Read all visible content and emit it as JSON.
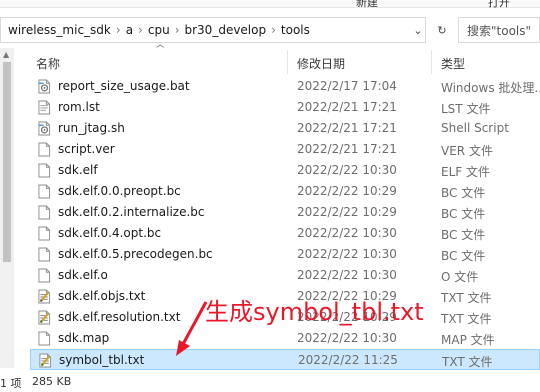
{
  "ribbon": {
    "left_label": "",
    "mid_label": "新建",
    "right_label": "打开"
  },
  "address": {
    "crumbs": [
      "wireless_mic_sdk",
      "a",
      "cpu",
      "br30_develop",
      "tools"
    ],
    "dropdown_glyph": "⌄",
    "refresh_glyph": "↻",
    "search_placeholder": "搜索\"tools\""
  },
  "columns": {
    "name": "名称",
    "date": "修改日期",
    "type": "类型"
  },
  "files": [
    {
      "name": "report_size_usage.bat",
      "date": "2022/2/17 17:04",
      "type": "Windows 批处理...",
      "icon": "batch-file-icon"
    },
    {
      "name": "rom.lst",
      "date": "2022/2/21 17:21",
      "type": "LST 文件",
      "icon": "text-file-icon"
    },
    {
      "name": "run_jtag.sh",
      "date": "2022/2/21 17:21",
      "type": "Shell Script",
      "icon": "script-file-icon"
    },
    {
      "name": "script.ver",
      "date": "2022/2/21 17:21",
      "type": "VER 文件",
      "icon": "blank-file-icon"
    },
    {
      "name": "sdk.elf",
      "date": "2022/2/22 10:30",
      "type": "ELF 文件",
      "icon": "blank-file-icon"
    },
    {
      "name": "sdk.elf.0.0.preopt.bc",
      "date": "2022/2/22 10:29",
      "type": "BC 文件",
      "icon": "blank-file-icon"
    },
    {
      "name": "sdk.elf.0.2.internalize.bc",
      "date": "2022/2/22 10:29",
      "type": "BC 文件",
      "icon": "blank-file-icon"
    },
    {
      "name": "sdk.elf.0.4.opt.bc",
      "date": "2022/2/22 10:30",
      "type": "BC 文件",
      "icon": "blank-file-icon"
    },
    {
      "name": "sdk.elf.0.5.precodegen.bc",
      "date": "2022/2/22 10:30",
      "type": "BC 文件",
      "icon": "blank-file-icon"
    },
    {
      "name": "sdk.elf.o",
      "date": "2022/2/22 10:30",
      "type": "O 文件",
      "icon": "blank-file-icon"
    },
    {
      "name": "sdk.elf.objs.txt",
      "date": "2022/2/22 10:29",
      "type": "TXT 文件",
      "icon": "notepad-file-icon"
    },
    {
      "name": "sdk.elf.resolution.txt",
      "date": "2022/2/22 10:29",
      "type": "TXT 文件",
      "icon": "notepad-file-icon"
    },
    {
      "name": "sdk.map",
      "date": "2022/2/22 10:30",
      "type": "MAP 文件",
      "icon": "blank-file-icon"
    },
    {
      "name": "symbol_tbl.txt",
      "date": "2022/2/22 11:25",
      "type": "TXT 文件",
      "icon": "notepad-file-icon",
      "selected": true
    }
  ],
  "annotation": {
    "text": "生成symbol_tbl.txt",
    "color": "#e8182a"
  },
  "status": {
    "count": "1 项",
    "size": "285 KB"
  },
  "colors": {
    "selection_bg": "#cce8ff",
    "selection_border": "#99d1ff"
  }
}
